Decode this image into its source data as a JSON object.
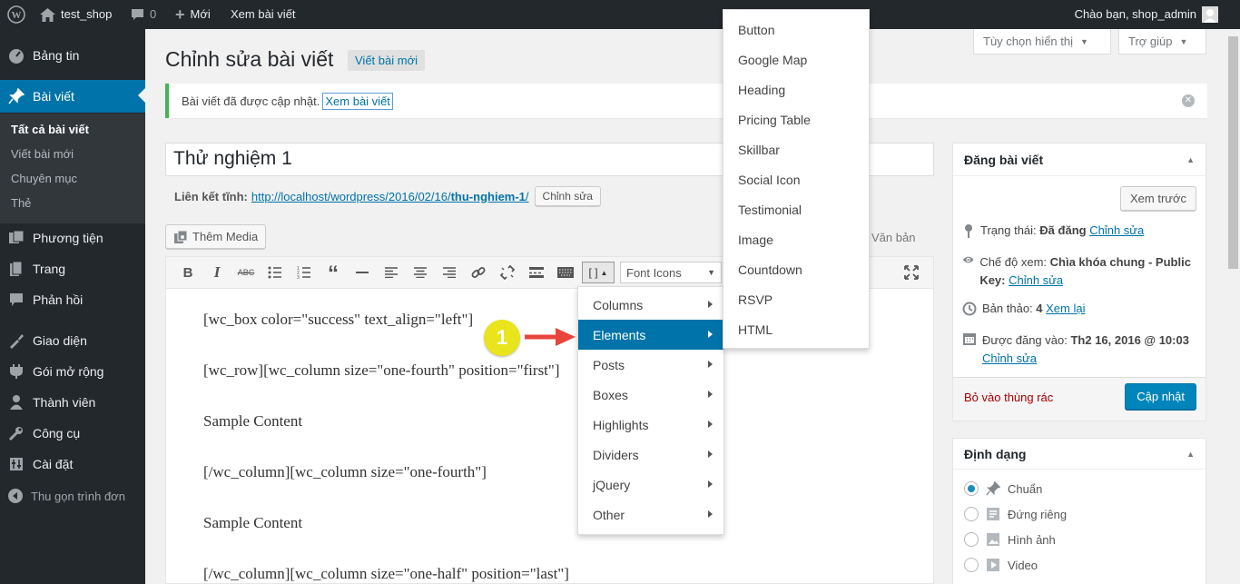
{
  "adminbar": {
    "site_name": "test_shop",
    "comments_count": "0",
    "new_label": "Mới",
    "view_post_label": "Xem bài viết",
    "greeting": "Chào bạn, shop_admin"
  },
  "sidebar": {
    "items": [
      {
        "label": "Bảng tin",
        "icon": "dashboard-icon"
      },
      {
        "label": "Bài viết",
        "icon": "pin-icon"
      },
      {
        "label": "Phương tiện",
        "icon": "media-icon"
      },
      {
        "label": "Trang",
        "icon": "page-icon"
      },
      {
        "label": "Phản hồi",
        "icon": "comment-icon"
      },
      {
        "label": "Giao diện",
        "icon": "appearance-icon"
      },
      {
        "label": "Gói mở rộng",
        "icon": "plugin-icon"
      },
      {
        "label": "Thành viên",
        "icon": "users-icon"
      },
      {
        "label": "Công cụ",
        "icon": "tools-icon"
      },
      {
        "label": "Cài đặt",
        "icon": "settings-icon"
      }
    ],
    "submenu": [
      "Tất cả bài viết",
      "Viết bài mới",
      "Chuyên mục",
      "Thẻ"
    ],
    "collapse_label": "Thu gọn trình đơn"
  },
  "header": {
    "title": "Chỉnh sửa bài viết",
    "add_new": "Viết bài mới",
    "screen_options": "Tùy chọn hiển thị",
    "help": "Trợ giúp"
  },
  "notice": {
    "text": "Bài viết đã được cập nhật.",
    "link": "Xem bài viết"
  },
  "post": {
    "title": "Thử nghiệm 1",
    "permalink_label": "Liên kết tĩnh:",
    "permalink_url": "http://localhost/wordpress/2016/02/16/",
    "permalink_slug": "thu-nghiem-1",
    "permalink_end": "/",
    "edit_slug": "Chỉnh sửa",
    "add_media": "Thêm Media",
    "text_tab": "Văn bản",
    "shortcode_button": "[ ]",
    "font_icons": "Font Icons"
  },
  "editor_lines": [
    "[wc_box color=\"success\" text_align=\"left\"]",
    "[wc_row][wc_column size=\"one-fourth\" position=\"first\"]",
    "Sample Content",
    "[/wc_column][wc_column size=\"one-fourth\"]",
    "Sample Content",
    "[/wc_column][wc_column size=\"one-half\" position=\"last\"]"
  ],
  "publish_box": {
    "title": "Đăng bài viết",
    "preview": "Xem trước",
    "status_label": "Trạng thái:",
    "status_value": "Đã đăng",
    "status_edit": "Chỉnh sửa",
    "visibility_label": "Chế độ xem:",
    "visibility_value": "Chìa khóa chung - Public Key:",
    "visibility_edit": "Chỉnh sửa",
    "revisions_label": "Bản thảo:",
    "revisions_value": "4",
    "revisions_link": "Xem lại",
    "published_label": "Được đăng vào:",
    "published_value": "Th2 16, 2016 @ 10:03",
    "published_edit": "Chỉnh sửa",
    "trash": "Bỏ vào thùng rác",
    "update": "Cập nhật"
  },
  "format_box": {
    "title": "Định dạng",
    "options": [
      "Chuẩn",
      "Đứng riêng",
      "Hình ảnh",
      "Video"
    ],
    "selected": "Chuẩn"
  },
  "shortcode_menu": {
    "items": [
      "Columns",
      "Elements",
      "Posts",
      "Boxes",
      "Highlights",
      "Dividers",
      "jQuery",
      "Other"
    ],
    "selected": "Elements"
  },
  "elements_submenu": {
    "items": [
      "Button",
      "Google Map",
      "Heading",
      "Pricing Table",
      "Skillbar",
      "Social Icon",
      "Testimonial",
      "Image",
      "Countdown",
      "RSVP",
      "HTML"
    ]
  },
  "annotation": {
    "number": "1",
    "color": "#e9e41b",
    "arrow_color": "#e8453c"
  },
  "colors": {
    "accent": "#0073aa",
    "admin_bg": "#23282d",
    "notice_border": "#46b450",
    "button_primary": "#0085ba"
  }
}
